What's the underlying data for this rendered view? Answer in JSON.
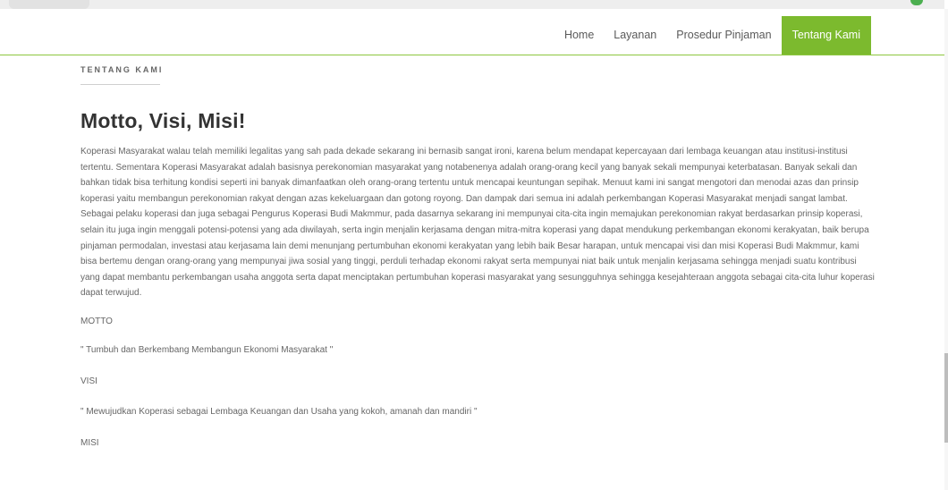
{
  "nav": {
    "items": [
      "Home",
      "Layanan",
      "Prosedur Pinjaman",
      "Tentang Kami"
    ],
    "active": "Tentang Kami"
  },
  "section": {
    "label": "TENTANG KAMI"
  },
  "main": {
    "title": "Motto, Visi, Misi!",
    "paragraph": "Koperasi Masyarakat walau telah memiliki legalitas yang sah pada dekade sekarang ini bernasib sangat ironi, karena belum mendapat kepercayaan dari lembaga keuangan atau institusi-institusi tertentu. Sementara Koperasi Masyarakat adalah basisnya perekonomian masyarakat yang notabenenya adalah orang-orang kecil yang banyak sekali mempunyai keterbatasan. Banyak sekali dan bahkan tidak bisa terhitung kondisi seperti ini banyak dimanfaatkan oleh orang-orang tertentu untuk mencapai keuntungan sepihak. Menuut kami ini sangat mengotori dan menodai azas dan prinsip koperasi yaitu membangun perekonomian rakyat dengan azas kekeluargaan dan gotong royong. Dan dampak dari semua ini adalah perkembangan Koperasi Masyarakat menjadi sangat lambat. Sebagai pelaku koperasi dan juga sebagai Pengurus Koperasi Budi Makmmur, pada dasarnya sekarang ini mempunyai cita-cita ingin memajukan perekonomian rakyat berdasarkan prinsip koperasi, selain itu juga ingin menggali potensi-potensi yang ada diwilayah, serta ingin menjalin kerjasama dengan mitra-mitra koperasi yang dapat mendukung perkembangan ekonomi kerakyatan, baik berupa pinjaman permodalan, investasi atau kerjasama lain demi menunjang pertumbuhan ekonomi kerakyatan yang lebih baik Besar harapan, untuk mencapai visi dan misi Koperasi Budi Makmmur, kami bisa bertemu dengan orang-orang yang mempunyai jiwa sosial yang tinggi, perduli terhadap ekonomi rakyat serta mempunyai niat baik untuk menjalin kerjasama sehingga menjadi suatu kontribusi yang dapat membantu perkembangan usaha anggota serta dapat menciptakan pertumbuhan koperasi masyarakat yang sesungguhnya sehingga kesejahteraan anggota sebagai cita-cita luhur koperasi dapat terwujud.",
    "motto_label": "MOTTO",
    "motto_text": "\" Tumbuh dan Berkembang Membangun Ekonomi Masyarakat \"",
    "visi_label": "VISI",
    "visi_text": "\" Mewujudkan Koperasi sebagai Lembaga Keuangan dan Usaha yang kokoh, amanah dan mandiri \"",
    "misi_label": "MISI"
  },
  "colors": {
    "accent": "#7cba2e",
    "nav_border": "#8cc63f",
    "title": "#333333",
    "body": "#666666"
  }
}
